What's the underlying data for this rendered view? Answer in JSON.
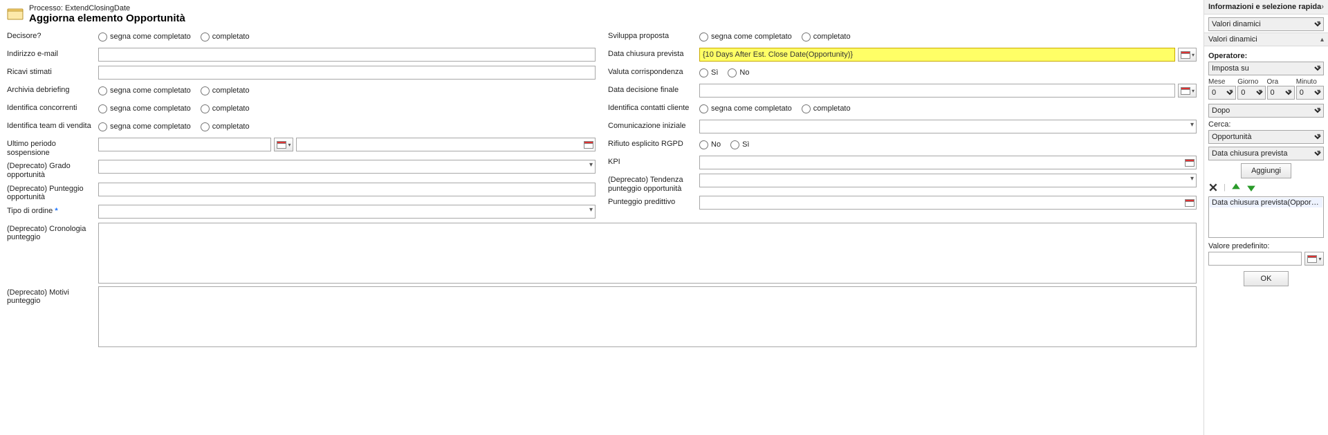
{
  "header": {
    "process_prefix": "Processo:",
    "process_name": "ExtendClosingDate",
    "title": "Aggiorna elemento Opportunità"
  },
  "radio": {
    "mark_completed": "segna come completato",
    "completed": "completato",
    "yes": "Sì",
    "no": "No"
  },
  "left": {
    "decisore": "Decisore?",
    "email": "Indirizzo e-mail",
    "ricavi": "Ricavi stimati",
    "debrief": "Archivia debriefing",
    "concorrenti": "Identifica concorrenti",
    "team": "Identifica team di vendita",
    "ultsosp": "Ultimo periodo sospensione",
    "grado": "(Deprecato) Grado opportunità",
    "punteggio": "(Deprecato) Punteggio opportunità",
    "tipo": "Tipo di ordine",
    "req_mark": "*",
    "cronologia": "(Deprecato) Cronologia punteggio",
    "motivi": "(Deprecato) Motivi punteggio"
  },
  "right": {
    "sviluppa": "Sviluppa proposta",
    "chiusura": "Data chiusura prevista",
    "chiusura_val": "{10 Days After Est. Close Date(Opportunity)}",
    "valcorr": "Valuta corrispondenza",
    "decfinale": "Data decisione finale",
    "contatti": "Identifica contatti cliente",
    "cominit": "Comunicazione iniziale",
    "rgpd": "Rifiuto esplicito RGPD",
    "kpi": "KPI",
    "tendenza": "(Deprecato) Tendenza punteggio opportunità",
    "predittivo": "Punteggio predittivo"
  },
  "side": {
    "title": "Informazioni e selezione rapida",
    "mode": "Valori dinamici",
    "subhdr": "Valori dinamici",
    "operatore": "Operatore:",
    "op_val": "Imposta su",
    "time": {
      "mese": "Mese",
      "giorno": "Giorno",
      "ora": "Ora",
      "minuto": "Minuto",
      "zero": "0"
    },
    "dopo": "Dopo",
    "cerca": "Cerca:",
    "search1": "Opportunità",
    "search2": "Data chiusura prevista",
    "add": "Aggiungi",
    "item": "Data chiusura prevista(Opportunità",
    "defval": "Valore predefinito:",
    "ok": "OK"
  }
}
